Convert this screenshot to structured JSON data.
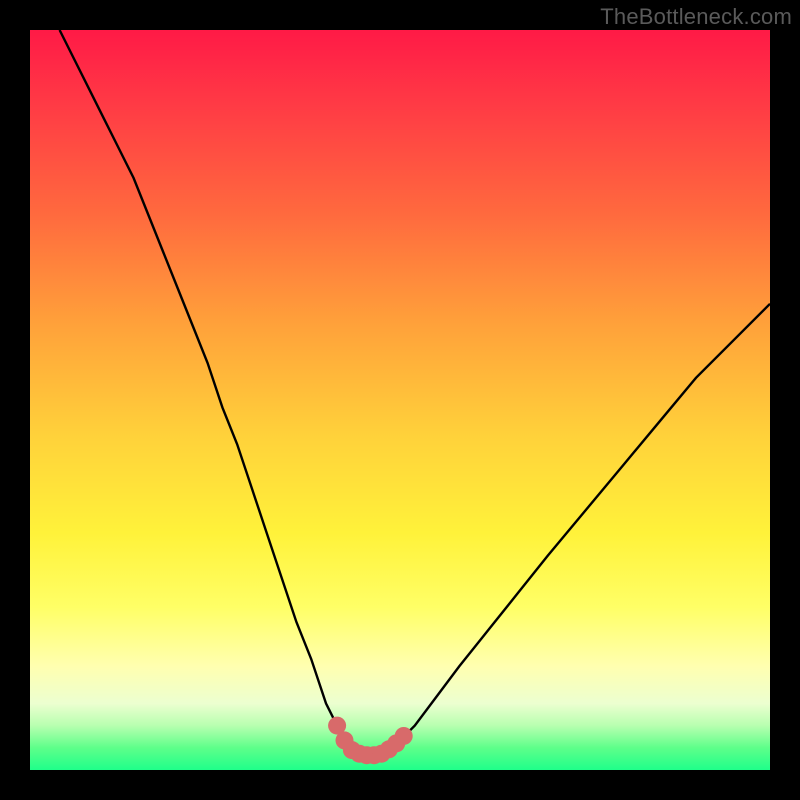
{
  "watermark": "TheBottleneck.com",
  "colors": {
    "frame": "#000000",
    "curve": "#000000",
    "markers": "#d86a6a",
    "gradient_top": "#ff1a46",
    "gradient_bottom": "#1fff8a"
  },
  "chart_data": {
    "type": "line",
    "title": "",
    "xlabel": "",
    "ylabel": "",
    "xlim": [
      0,
      100
    ],
    "ylim": [
      0,
      100
    ],
    "grid": false,
    "series": [
      {
        "name": "curve",
        "x": [
          4,
          6,
          8,
          10,
          12,
          14,
          16,
          18,
          20,
          22,
          24,
          26,
          28,
          30,
          32,
          34,
          36,
          38,
          40,
          42,
          43,
          44,
          45,
          46,
          47,
          48,
          49,
          50,
          52,
          55,
          58,
          62,
          66,
          70,
          75,
          80,
          85,
          90,
          95,
          100
        ],
        "y": [
          100,
          96,
          92,
          88,
          84,
          80,
          75,
          70,
          65,
          60,
          55,
          49,
          44,
          38,
          32,
          26,
          20,
          15,
          9,
          5,
          3.5,
          2.5,
          2,
          2,
          2,
          2.3,
          3,
          4,
          6,
          10,
          14,
          19,
          24,
          29,
          35,
          41,
          47,
          53,
          58,
          63
        ]
      }
    ],
    "markers": [
      {
        "x": 41.5,
        "y": 6
      },
      {
        "x": 42.5,
        "y": 4
      },
      {
        "x": 43.5,
        "y": 2.7
      },
      {
        "x": 44.5,
        "y": 2.2
      },
      {
        "x": 45.5,
        "y": 2.0
      },
      {
        "x": 46.5,
        "y": 2.0
      },
      {
        "x": 47.5,
        "y": 2.2
      },
      {
        "x": 48.5,
        "y": 2.8
      },
      {
        "x": 49.5,
        "y": 3.6
      },
      {
        "x": 50.5,
        "y": 4.6
      }
    ]
  }
}
